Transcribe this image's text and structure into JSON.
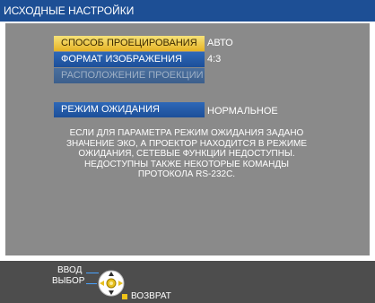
{
  "header": {
    "title": "ИСХОДНЫЕ НАСТРОЙКИ"
  },
  "menu": {
    "items": [
      {
        "label": "СПОСОБ ПРОЕЦИРОВАНИЯ",
        "value": "АВТО",
        "state": "selected"
      },
      {
        "label": "ФОРМАТ ИЗОБРАЖЕНИЯ",
        "value": "4:3",
        "state": "normal"
      },
      {
        "label": "РАСПОЛОЖЕНИЕ ПРОЕКЦИИ",
        "value": "",
        "state": "disabled"
      },
      {
        "label": "РЕЖИМ ОЖИДАНИЯ",
        "value": "НОРМАЛЬНОЕ",
        "state": "normal"
      }
    ]
  },
  "message": {
    "lines": [
      "ЕСЛИ ДЛЯ ПАРАМЕТРА РЕЖИМ ОЖИДАНИЯ ЗАДАНО",
      "ЗНАЧЕНИЕ ЭКО, А ПРОЕКТОР НАХОДИТСЯ В РЕЖИМЕ",
      "ОЖИДАНИЯ, СЕТЕВЫЕ ФУНКЦИИ НЕДОСТУПНЫ.",
      "НЕДОСТУПНЫ ТАКЖЕ НЕКОТОРЫЕ КОМАНДЫ",
      "ПРОТОКОЛА RS-232C."
    ]
  },
  "footer": {
    "enter_label": "ВВОД",
    "select_label": "ВЫБОР",
    "return_label": "ВОЗВРАТ",
    "icons": [
      "dpad-icon",
      "return-button-icon"
    ]
  },
  "colors": {
    "title_bar": "#1d4f95",
    "panel": "#8a8a8a",
    "button_selected": "#e6b324",
    "button_normal": "#1c4f99",
    "footer": "#4d4d4d"
  }
}
